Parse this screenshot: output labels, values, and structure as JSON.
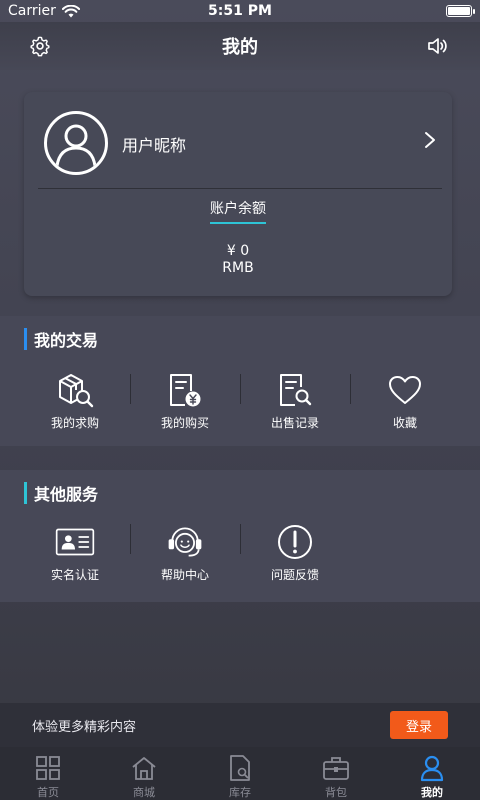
{
  "status_bar": {
    "carrier": "Carrier",
    "time": "5:51 PM"
  },
  "header": {
    "title": "我的"
  },
  "profile": {
    "nickname": "用户昵称",
    "balance_label": "账户余额",
    "balance_value": "¥ 0",
    "balance_unit": "RMB"
  },
  "trade": {
    "title": "我的交易",
    "items": [
      {
        "label": "我的求购",
        "icon": "box-search-icon"
      },
      {
        "label": "我的购买",
        "icon": "receipt-yuan-icon"
      },
      {
        "label": "出售记录",
        "icon": "document-search-icon"
      },
      {
        "label": "收藏",
        "icon": "heart-icon"
      }
    ]
  },
  "services": {
    "title": "其他服务",
    "items": [
      {
        "label": "实名认证",
        "icon": "id-card-icon"
      },
      {
        "label": "帮助中心",
        "icon": "headset-icon"
      },
      {
        "label": "问题反馈",
        "icon": "exclamation-circle-icon"
      }
    ]
  },
  "login_bar": {
    "text": "体验更多精彩内容",
    "button_label": "登录",
    "button_color": "#f25a1a"
  },
  "tabs": [
    {
      "label": "首页",
      "icon": "grid-icon",
      "active": false
    },
    {
      "label": "商城",
      "icon": "home-icon",
      "active": false
    },
    {
      "label": "库存",
      "icon": "inventory-icon",
      "active": false
    },
    {
      "label": "背包",
      "icon": "backpack-icon",
      "active": false
    },
    {
      "label": "我的",
      "icon": "person-icon",
      "active": true
    }
  ],
  "colors": {
    "accent": "#2a8ef0",
    "teal": "#2ec4d6",
    "active_tab": "#2a8ef0"
  }
}
